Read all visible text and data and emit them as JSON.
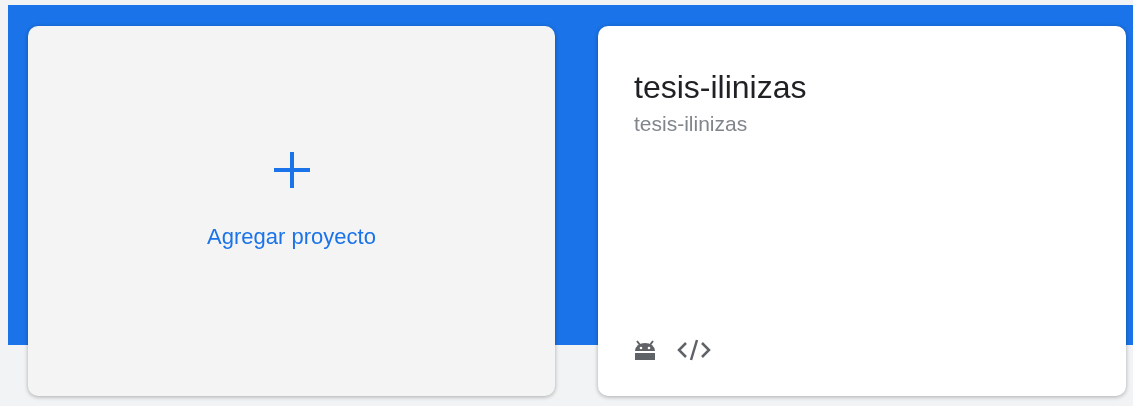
{
  "add_card": {
    "label": "Agregar proyecto"
  },
  "projects": [
    {
      "name": "tesis-ilinizas",
      "id": "tesis-ilinizas",
      "platforms": [
        {
          "kind": "android"
        },
        {
          "kind": "web"
        }
      ]
    }
  ]
}
